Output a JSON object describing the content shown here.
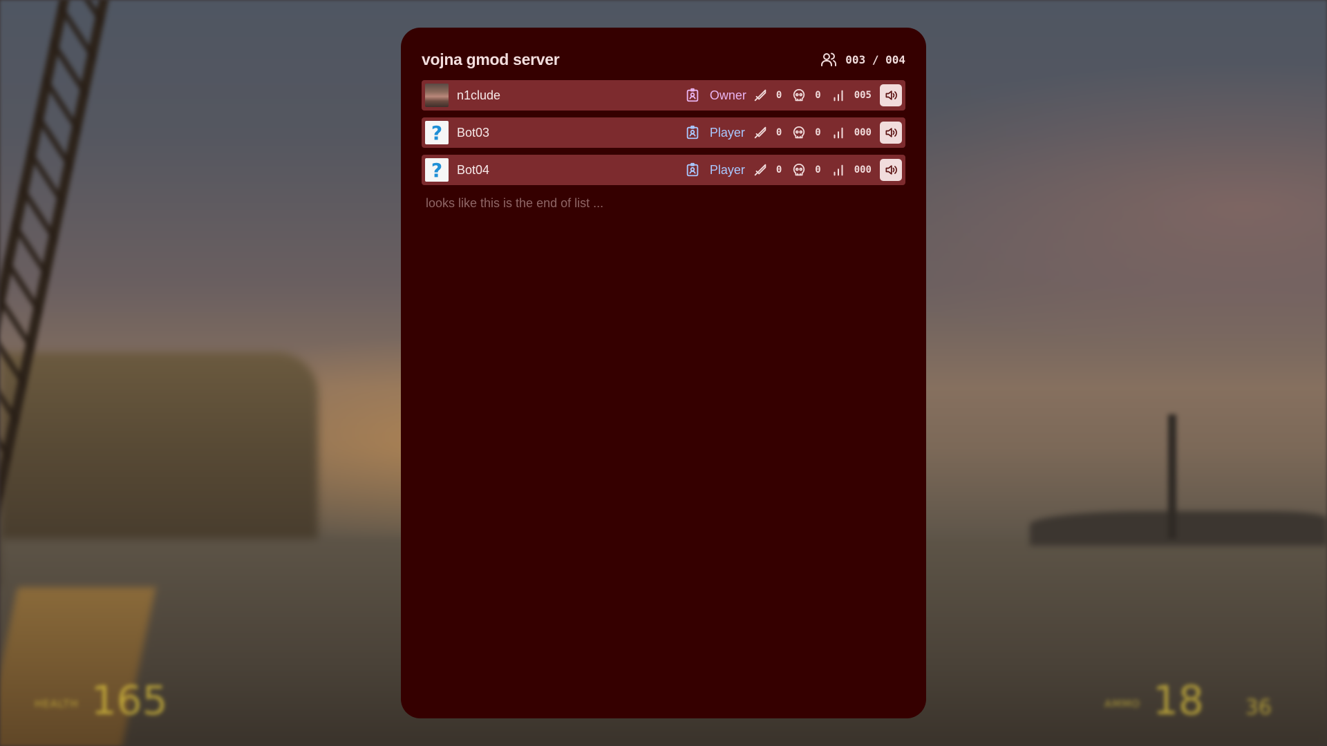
{
  "server": {
    "name": "vojna gmod server",
    "player_count": "003 / 004"
  },
  "players": [
    {
      "name": "n1clude",
      "avatar": "custom-avatar",
      "rank": "Owner",
      "kills": "0",
      "deaths": "0",
      "ping": "005"
    },
    {
      "name": "Bot03",
      "avatar": "question-mark",
      "rank": "Player",
      "kills": "0",
      "deaths": "0",
      "ping": "000"
    },
    {
      "name": "Bot04",
      "avatar": "question-mark",
      "rank": "Player",
      "kills": "0",
      "deaths": "0",
      "ping": "000"
    }
  ],
  "end_of_list": "looks like this is the end of list ...",
  "hud": {
    "health_label": "HEALTH",
    "health": "165",
    "ammo_label": "AMMO",
    "ammo": "18",
    "ammo_reserve": "36"
  },
  "colors": {
    "panel": "#350000",
    "row": "#7d2b2e",
    "owner_rank": "#e9b4f0",
    "player_rank": "#a9c8ff"
  }
}
